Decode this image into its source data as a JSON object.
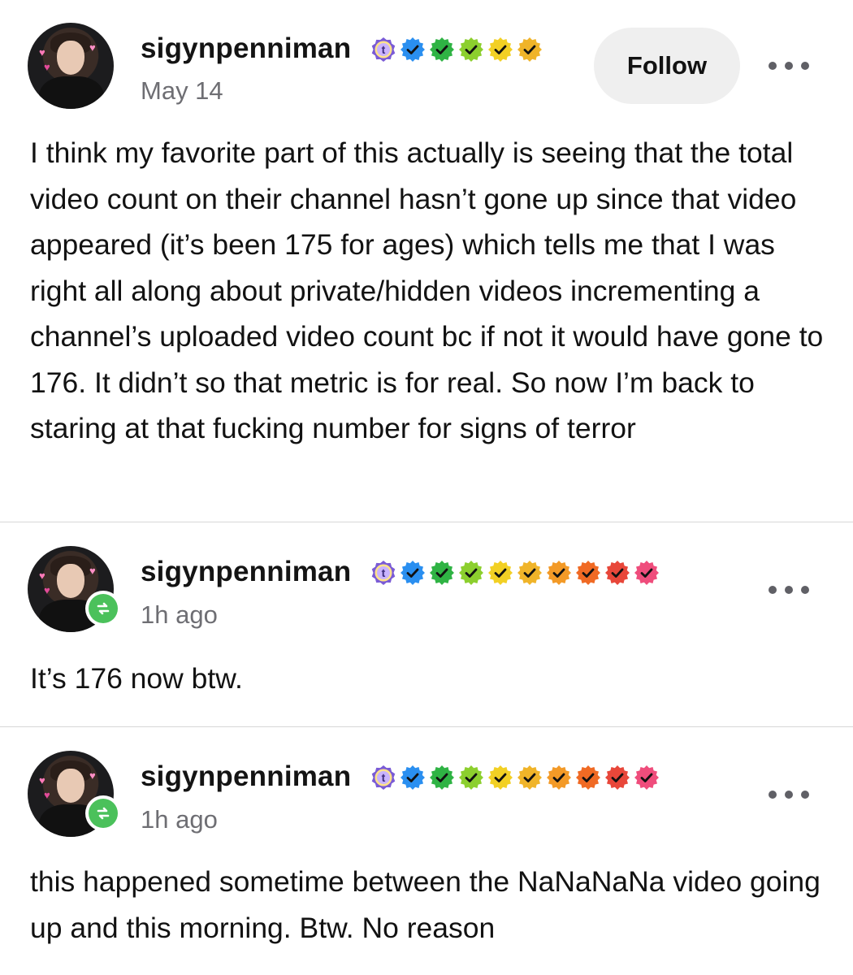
{
  "posts": [
    {
      "username": "sigynpenniman",
      "timestamp": "May 14",
      "follow_label": "Follow",
      "body": "I think my favorite part of this actually is seeing that the total video count on their channel hasn’t gone up since that video appeared (it’s been 175 for ages) which tells me that I was right all along about private/hidden videos incrementing a channel’s uploaded video count bc if not it would have gone to 176. It didn’t so that metric is for real. So now I’m back to staring at that fucking number for signs of terror",
      "badges": [
        "tumblr-badge-icon",
        "blue-check-icon",
        "green-check-icon",
        "lime-check-icon",
        "yellow-check-icon",
        "gold-check-icon"
      ]
    },
    {
      "username": "sigynpenniman",
      "timestamp": "1h ago",
      "body": "It’s 176 now btw.",
      "badges": [
        "tumblr-badge-icon",
        "blue-check-icon",
        "green-check-icon",
        "lime-check-icon",
        "yellow-check-icon",
        "gold-check-icon",
        "orange-check-icon",
        "dark-orange-check-icon",
        "red-check-icon",
        "pink-check-icon"
      ]
    },
    {
      "username": "sigynpenniman",
      "timestamp": "1h ago",
      "body": "this happened sometime between the NaNaNaNa video going up and this morning. Btw. No reason",
      "badges": [
        "tumblr-badge-icon",
        "blue-check-icon",
        "green-check-icon",
        "lime-check-icon",
        "yellow-check-icon",
        "gold-check-icon",
        "orange-check-icon",
        "dark-orange-check-icon",
        "red-check-icon",
        "pink-check-icon"
      ]
    }
  ],
  "colors": {
    "blue": "#2a8ff0",
    "green": "#2fb344",
    "lime": "#8ccf2e",
    "yellow": "#f2d024",
    "gold": "#f0b429",
    "orange": "#f39a27",
    "dark_orange": "#f06a24",
    "red": "#e8473a",
    "pink": "#ef4d7c",
    "tumblr_purple": "#7a5bd6",
    "reblog_green": "#4bc15b"
  }
}
